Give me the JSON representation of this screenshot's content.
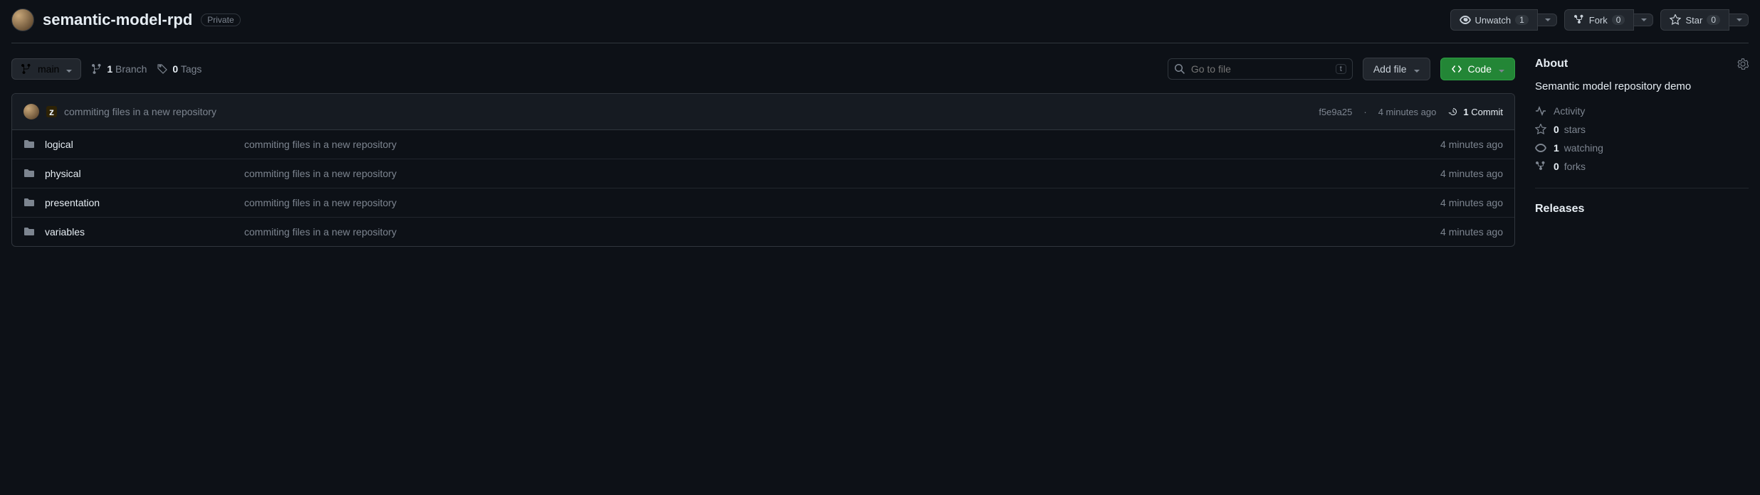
{
  "header": {
    "repo_name": "semantic-model-rpd",
    "visibility": "Private",
    "unwatch_label": "Unwatch",
    "unwatch_count": "1",
    "fork_label": "Fork",
    "fork_count": "0",
    "star_label": "Star",
    "star_count": "0"
  },
  "toolbar": {
    "branch": "main",
    "branches_count": "1",
    "branches_label": "Branch",
    "tags_count": "0",
    "tags_label": "Tags",
    "search_placeholder": "Go to file",
    "search_kbd": "t",
    "add_file_label": "Add file",
    "code_label": "Code"
  },
  "latest_commit": {
    "author": "z",
    "message": "commiting files in a new repository",
    "sha": "f5e9a25",
    "sep": "·",
    "time": "4 minutes ago",
    "commits_count": "1",
    "commits_label": "Commit"
  },
  "files": [
    {
      "name": "logical",
      "message": "commiting files in a new repository",
      "time": "4 minutes ago"
    },
    {
      "name": "physical",
      "message": "commiting files in a new repository",
      "time": "4 minutes ago"
    },
    {
      "name": "presentation",
      "message": "commiting files in a new repository",
      "time": "4 minutes ago"
    },
    {
      "name": "variables",
      "message": "commiting files in a new repository",
      "time": "4 minutes ago"
    }
  ],
  "about": {
    "title": "About",
    "description": "Semantic model repository demo",
    "activity_label": "Activity",
    "stars_count": "0",
    "stars_label": "stars",
    "watching_count": "1",
    "watching_label": "watching",
    "forks_count": "0",
    "forks_label": "forks"
  },
  "releases": {
    "title": "Releases"
  }
}
